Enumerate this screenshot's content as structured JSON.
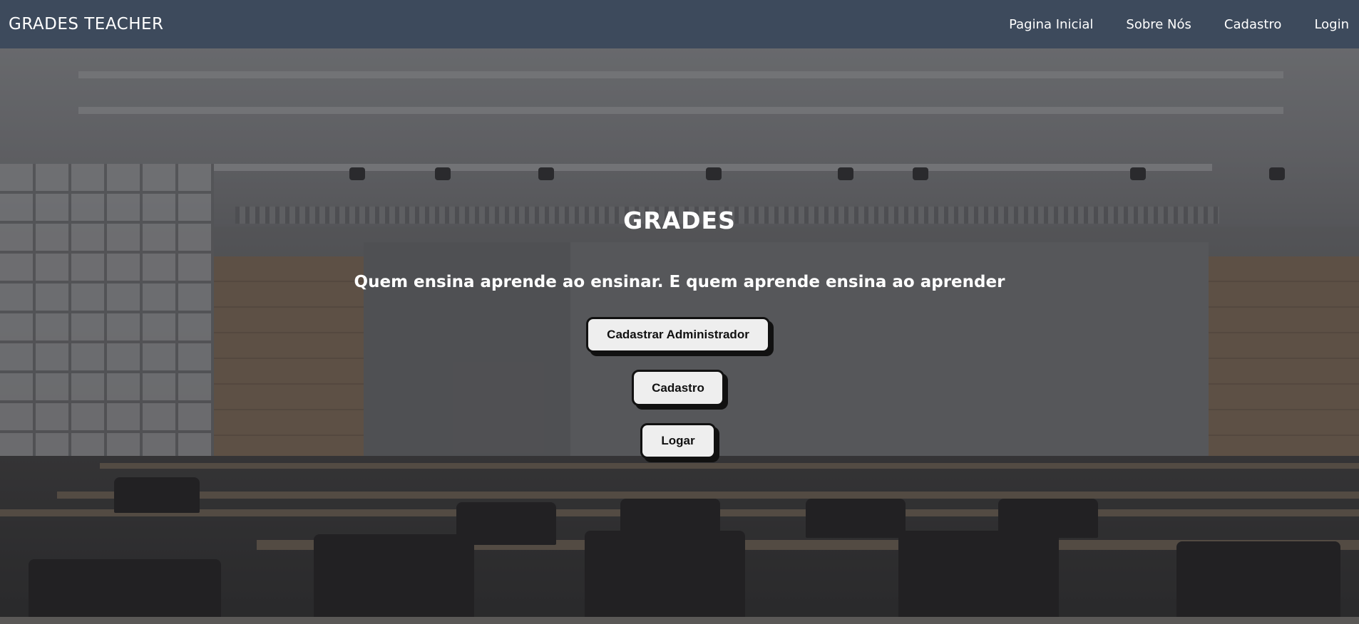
{
  "navbar": {
    "brand": "GRADES TEACHER",
    "links": [
      {
        "label": "Pagina Inicial"
      },
      {
        "label": "Sobre Nós"
      },
      {
        "label": "Cadastro"
      },
      {
        "label": "Login"
      }
    ]
  },
  "hero": {
    "title": "GRADES",
    "quote": "Quem ensina aprende ao ensinar. E quem aprende ensina ao aprender",
    "buttons": {
      "admin": "Cadastrar Administrador",
      "cadastro": "Cadastro",
      "logar": "Logar"
    }
  },
  "colors": {
    "navbar_bg": "#3d4a5c",
    "text": "#ffffff",
    "button_bg": "#eeeeee",
    "button_border": "#111111"
  }
}
